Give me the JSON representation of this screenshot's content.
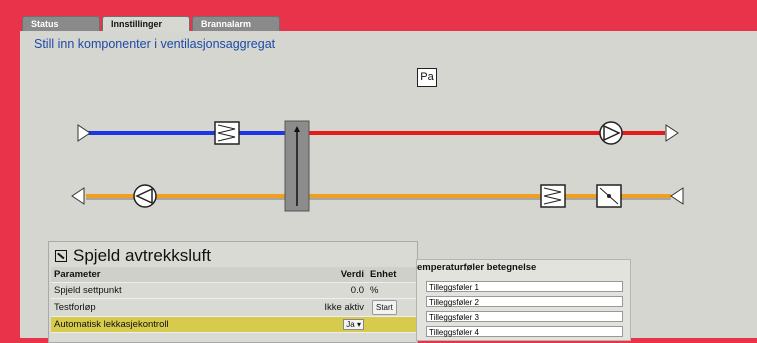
{
  "tabs": [
    {
      "label": "Status"
    },
    {
      "label": "Innstillinger"
    },
    {
      "label": "Brannalarm"
    }
  ],
  "page_title": "Still inn komponenter i ventilasjonsaggregat",
  "pressure_sensor_label": "Pa",
  "colors": {
    "background_red": "#e8334a",
    "panel": "#d6d6d0",
    "supply_duct": "#1f36e6",
    "exhaust_duct": "#e51b1b",
    "return_duct": "#f0a020",
    "highlight": "#d7cb4e"
  },
  "damper_panel": {
    "title": "Spjeld avtrekksluft",
    "headers": {
      "param": "Parameter",
      "value": "Verdi",
      "unit": "Enhet"
    },
    "rows": [
      {
        "param": "Spjeld settpunkt",
        "value": "0.0",
        "unit": "%"
      },
      {
        "param": "Testforløp",
        "value": "Ikke aktiv",
        "button": "Start"
      },
      {
        "param": "Automatisk lekkasjekontroll",
        "select": "Ja"
      }
    ]
  },
  "sensor_panel": {
    "title": "emperaturføler betegnelse",
    "fields": [
      "Tilleggsføler 1",
      "Tilleggsføler 2",
      "Tilleggsføler 3",
      "Tilleggsføler 4"
    ]
  }
}
